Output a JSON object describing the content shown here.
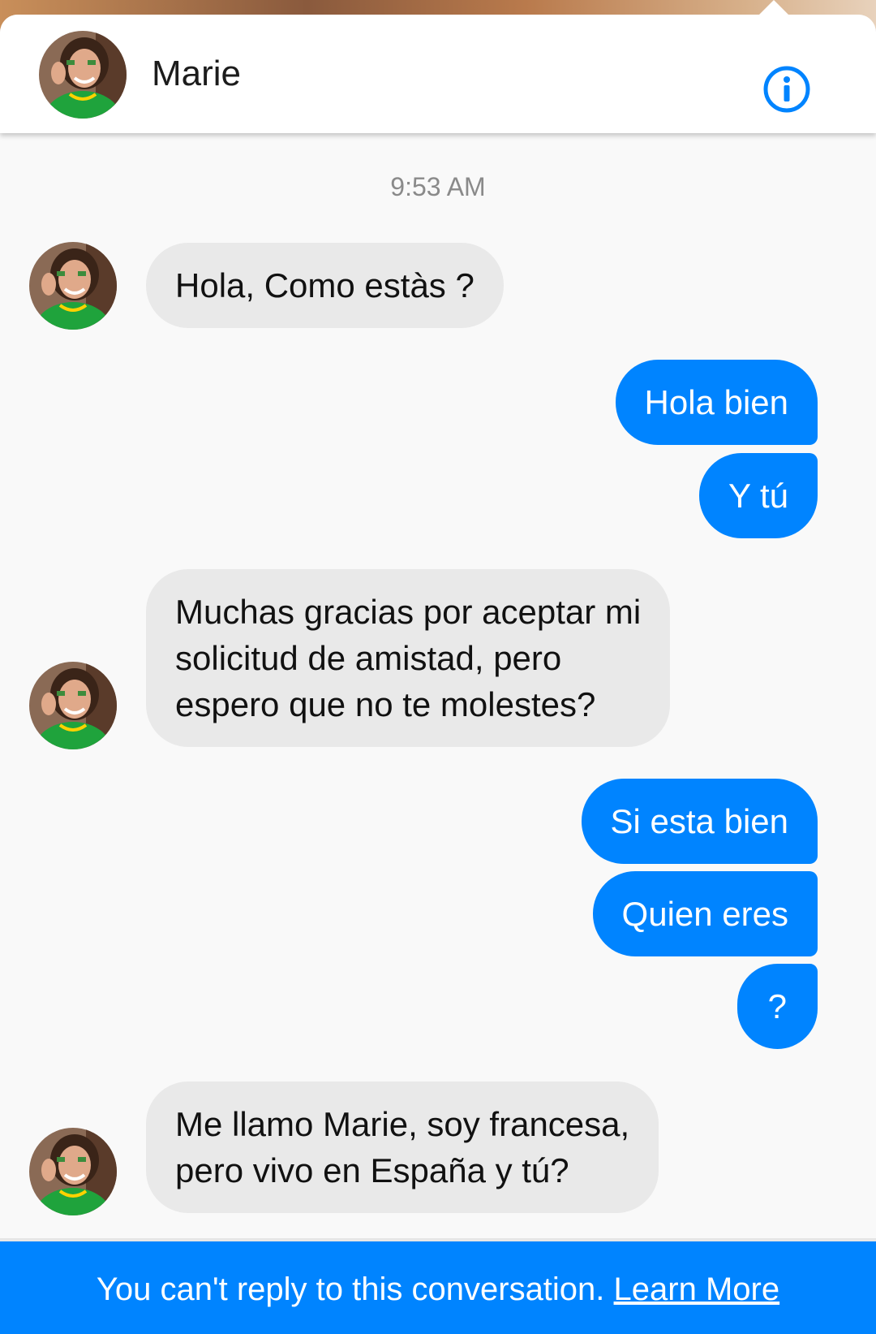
{
  "conversation": {
    "contact_name": "Marie",
    "timestamp": "9:53 AM"
  },
  "messages": [
    {
      "from": "contact",
      "text": "Hola, Como estàs ?"
    },
    {
      "from": "me",
      "text": "Hola bien"
    },
    {
      "from": "me",
      "text": "Y tú"
    },
    {
      "from": "contact",
      "text": "Muchas gracias por aceptar mi\nsolicitud de amistad, pero\nespero que no te molestes?"
    },
    {
      "from": "me",
      "text": "Si esta bien"
    },
    {
      "from": "me",
      "text": "Quien eres"
    },
    {
      "from": "me",
      "text": "?"
    },
    {
      "from": "contact",
      "text": "Me llamo Marie, soy francesa,\npero vivo en España y tú?"
    }
  ],
  "footer": {
    "notice": "You can't reply to this conversation.",
    "link_label": "Learn More"
  },
  "icons": {
    "info": "info-icon",
    "avatar": "contact-avatar"
  },
  "colors": {
    "accent": "#0084ff",
    "incoming_bubble": "#e9e9e9",
    "background": "#f9f9f9"
  }
}
